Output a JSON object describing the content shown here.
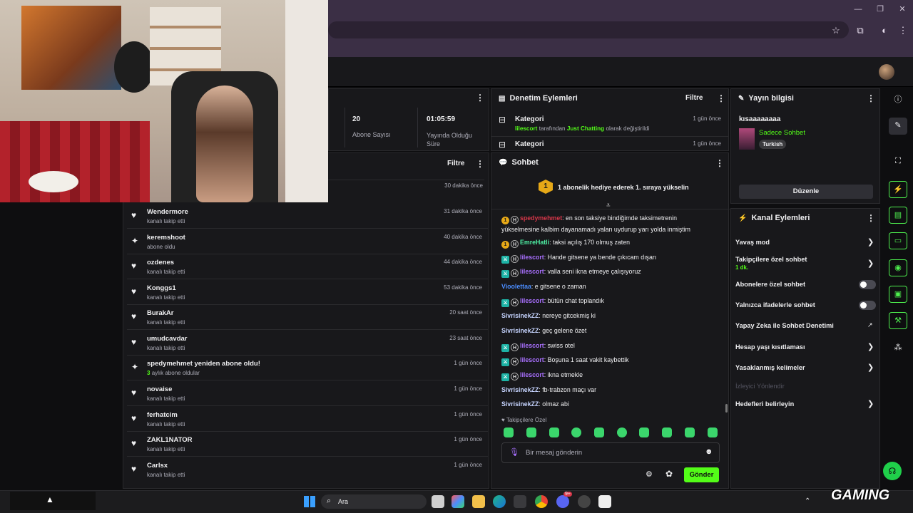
{
  "colors": {
    "accent": "#53fc18",
    "panel": "#18181b",
    "background": "#0e0e10",
    "chrome": "#3b2f45"
  },
  "stats": [
    {
      "value": "20",
      "label": "Abone Sayısı"
    },
    {
      "value": "01:05:59",
      "label": "Yayında Olduğu Süre"
    }
  ],
  "mod_actions": {
    "title": "Denetim Eylemleri",
    "filter": "Filtre",
    "items": [
      {
        "title": "Kategori",
        "time": "1 gün önce",
        "user": "lilescort",
        "mid": "tarafından",
        "category": "Just Chatting",
        "end": "olarak değiştirildi"
      },
      {
        "title": "Kategori",
        "time": "1 gün önce"
      }
    ]
  },
  "activity": {
    "filter": "Filtre",
    "first_time": "30 dakika önce",
    "rows": [
      {
        "icon": "heart-icon",
        "name": "Wendermore",
        "action": "kanalı takip etti",
        "time": "31 dakika önce"
      },
      {
        "icon": "sparkle-icon",
        "name": "keremshoot",
        "action": "abone oldu",
        "time": "40 dakika önce"
      },
      {
        "icon": "heart-icon",
        "name": "ozdenes",
        "action": "kanalı takip etti",
        "time": "44 dakika önce"
      },
      {
        "icon": "heart-icon",
        "name": "Konggs1",
        "action": "kanalı takip etti",
        "time": "53 dakika önce"
      },
      {
        "icon": "heart-icon",
        "name": "BurakAr",
        "action": "kanalı takip etti",
        "time": "20 saat önce"
      },
      {
        "icon": "heart-icon",
        "name": "umudcavdar",
        "action": "kanalı takip etti",
        "time": "23 saat önce"
      },
      {
        "icon": "sparkle-icon",
        "name": "spedymehmet yeniden abone oldu!",
        "action_count": "3",
        "action": "aylık abone oldular",
        "time": "1 gün önce"
      },
      {
        "icon": "heart-icon",
        "name": "novaise",
        "action": "kanalı takip etti",
        "time": "1 gün önce"
      },
      {
        "icon": "heart-icon",
        "name": "ferhatcim",
        "action": "kanalı takip etti",
        "time": "1 gün önce"
      },
      {
        "icon": "heart-icon",
        "name": "ZAKL1NATOR",
        "action": "kanalı takip etti",
        "time": "1 gün önce"
      },
      {
        "icon": "heart-icon",
        "name": "Carlsx",
        "action": "kanalı takip etti",
        "time": "1 gün önce"
      }
    ]
  },
  "chat": {
    "title": "Sohbet",
    "gift_banner": "1 abonelik hediye ederek 1. sıraya yükselin",
    "messages": [
      {
        "user": "spedymehmet",
        "text": ": en son taksiye bindiğimde taksimetrenin yükselmesine kalbim dayanamadı yalan uydurup yarı yolda inmiştim"
      },
      {
        "user": "EmreHatli",
        "text": ": taksi açılış 170 olmuş zaten"
      },
      {
        "user": "lilescort",
        "text": ": Hande gitsene ya bende çıkıcam dışarı"
      },
      {
        "user": "lilescort",
        "text": ": valla seni ikna etmeye çalışıyoruz"
      },
      {
        "user": "Vioolettaa",
        "text": ": e gitsene o zaman"
      },
      {
        "user": "lilescort",
        "text": ": bütün chat toplandık"
      },
      {
        "user": "SivrisinekZZ",
        "text": ": nereye gitcekmiş ki"
      },
      {
        "user": "SivrisinekZZ",
        "text": ": geç gelene özet"
      },
      {
        "user": "lilescort",
        "text": ": swiss otel"
      },
      {
        "user": "lilescort",
        "text": ": Boşuna 1 saat vakit kaybettik"
      },
      {
        "user": "lilescort",
        "text": ": ikna etmekle"
      },
      {
        "user": "SivrisinekZZ",
        "text": ": fb-trabzon maçı var"
      },
      {
        "user": "SivrisinekZZ",
        "text": ": olmaz abi"
      }
    ],
    "followers_only_label": "Takipçilere Özel",
    "input_placeholder": "Bir mesaj gönderin",
    "send_label": "Gönder"
  },
  "stream_info": {
    "title": "Yayın bilgisi",
    "stream_title": "kısaaaaaaaa",
    "category": "Sadece Sohbet",
    "language_tag": "Turkish",
    "edit_label": "Düzenle"
  },
  "channel_actions": {
    "title": "Kanal Eylemleri",
    "slow_mode": "Yavaş mod",
    "followers_only": "Takipçilere özel sohbet",
    "followers_only_value": "1 dk.",
    "subs_only": "Abonelere özel sohbet",
    "emotes_only": "Yalnızca ifadelerle sohbet",
    "ai_moderation": "Yapay Zeka ile Sohbet Denetimi",
    "account_age": "Hesap yaşı kısıtlaması",
    "banned_words": "Yasaklanmış kelimeler",
    "raid": "İzleyici Yönlendir",
    "goals": "Hedefleri belirleyin"
  },
  "taskbar": {
    "search_label": "Ara",
    "notification_badge": "9+"
  },
  "overlay": {
    "logo_text": "GAMING"
  }
}
